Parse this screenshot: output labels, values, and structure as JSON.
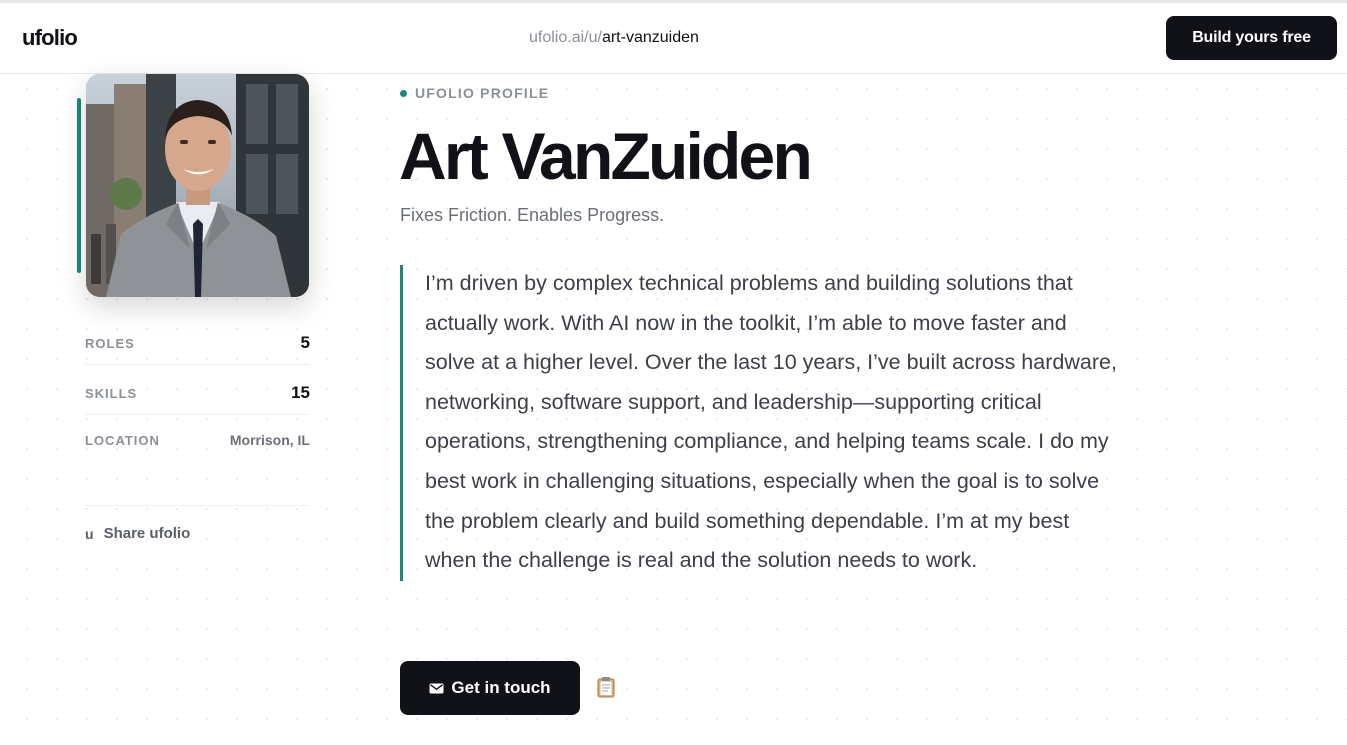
{
  "header": {
    "logo": "ufolio",
    "url_base": "ufolio.ai/u/",
    "url_slug": "art-vanzuiden",
    "cta_label": "Build yours free"
  },
  "profile": {
    "eyebrow": "UFOLIO PROFILE",
    "name": "Art VanZuiden",
    "tagline": "Fixes Friction. Enables Progress.",
    "bio": "I’m driven by complex technical problems and building solutions that actually work. With AI now in the toolkit, I’m able to move faster and solve at a higher level. Over the last 10 years, I’ve built across hardware, networking, software support, and leadership—supporting critical operations, strengthening compliance, and helping teams scale. I do my best work in challenging situations, especially when the goal is to solve the problem clearly and build something dependable. I’m at my best when the challenge is real and the solution needs to work.",
    "contact_label": "Get in touch"
  },
  "stats": [
    {
      "label": "ROLES",
      "value": "5"
    },
    {
      "label": "SKILLS",
      "value": "15"
    },
    {
      "label": "LOCATION",
      "value": "Morrison, IL"
    }
  ],
  "share": {
    "icon_text": "u",
    "label": "Share ufolio"
  },
  "icons": {
    "mail": "mail-icon",
    "copy": "clipboard-icon",
    "avatar": "profile-photo"
  },
  "colors": {
    "accent": "#1b8a7a",
    "button_bg": "#111217",
    "text_muted": "#8b8f98"
  }
}
